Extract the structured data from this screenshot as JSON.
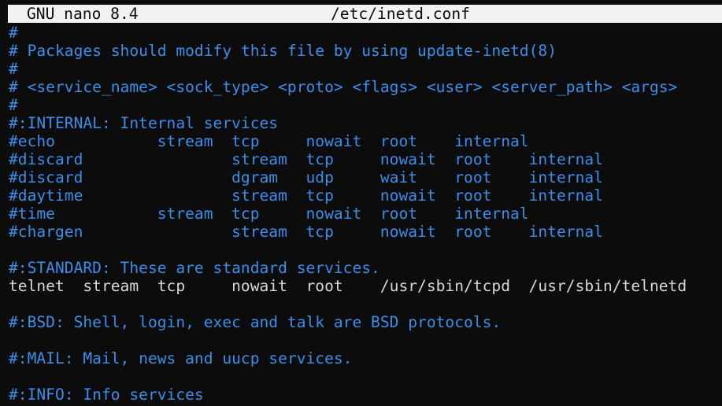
{
  "titlebar": {
    "app": "GNU nano 8.4",
    "filename": "/etc/inetd.conf"
  },
  "lines": [
    {
      "text": "#",
      "kind": "comment"
    },
    {
      "text": "# Packages should modify this file by using update-inetd(8)",
      "kind": "comment"
    },
    {
      "text": "#",
      "kind": "comment"
    },
    {
      "text": "# <service_name> <sock_type> <proto> <flags> <user> <server_path> <args>",
      "kind": "comment"
    },
    {
      "text": "#",
      "kind": "comment"
    },
    {
      "text": "#:INTERNAL: Internal services",
      "kind": "comment"
    },
    {
      "text": "#echo           stream  tcp     nowait  root    internal",
      "kind": "comment"
    },
    {
      "text": "#discard                stream  tcp     nowait  root    internal",
      "kind": "comment"
    },
    {
      "text": "#discard                dgram   udp     wait    root    internal",
      "kind": "comment"
    },
    {
      "text": "#daytime                stream  tcp     nowait  root    internal",
      "kind": "comment"
    },
    {
      "text": "#time           stream  tcp     nowait  root    internal",
      "kind": "comment"
    },
    {
      "text": "#chargen                stream  tcp     nowait  root    internal",
      "kind": "comment"
    },
    {
      "text": "",
      "kind": "blank"
    },
    {
      "text": "#:STANDARD: These are standard services.",
      "kind": "comment"
    },
    {
      "text": "telnet  stream  tcp     nowait  root    /usr/sbin/tcpd  /usr/sbin/telnetd",
      "kind": "plain"
    },
    {
      "text": "",
      "kind": "blank"
    },
    {
      "text": "#:BSD: Shell, login, exec and talk are BSD protocols.",
      "kind": "comment"
    },
    {
      "text": "",
      "kind": "blank"
    },
    {
      "text": "#:MAIL: Mail, news and uucp services.",
      "kind": "comment"
    },
    {
      "text": "",
      "kind": "blank"
    },
    {
      "text": "#:INFO: Info services",
      "kind": "comment"
    }
  ],
  "colors": {
    "background": "#0c0c0c",
    "titlebar_bg": "#f2f2f2",
    "comment": "#3b8eea",
    "plain": "#d8d8d8"
  }
}
